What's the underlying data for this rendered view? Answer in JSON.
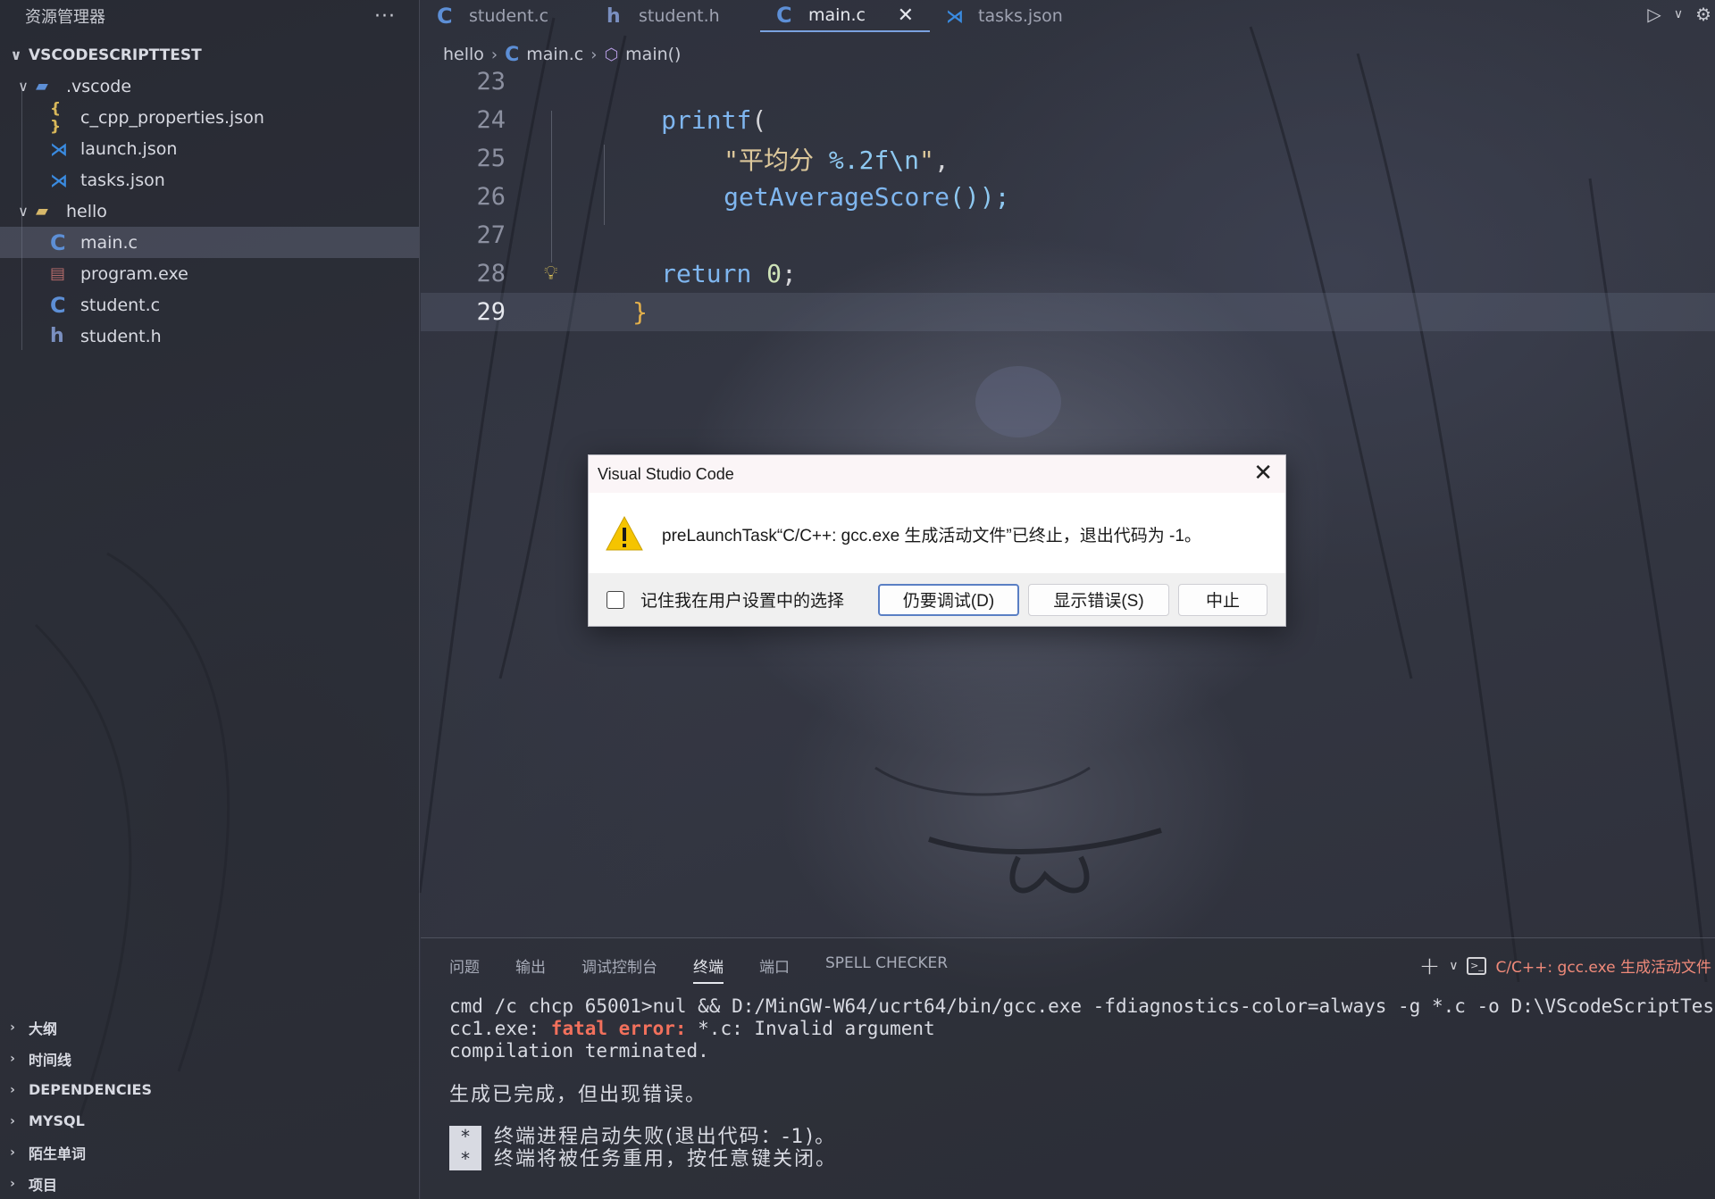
{
  "sidebar": {
    "title": "资源管理器",
    "more": "···",
    "root": "VSCODESCRIPTTEST",
    "tree": {
      "vscode_folder": ".vscode",
      "c_cpp_properties": "c_cpp_properties.json",
      "launch": "launch.json",
      "tasks": "tasks.json",
      "hello_folder": "hello",
      "main_c": "main.c",
      "program_exe": "program.exe",
      "student_c": "student.c",
      "student_h": "student.h"
    },
    "sections": [
      "大纲",
      "时间线",
      "DEPENDENCIES",
      "MYSQL",
      "陌生单词",
      "项目"
    ]
  },
  "tabs": [
    "student.c",
    "student.h",
    "main.c",
    "tasks.json"
  ],
  "breadcrumb": {
    "folder": "hello",
    "file": "main.c",
    "symbol": "main()"
  },
  "editor": {
    "line_numbers": [
      "23",
      "24",
      "25",
      "26",
      "27",
      "28",
      "29"
    ],
    "l24": {
      "fn": "printf",
      "paren": "("
    },
    "l25": {
      "str_open": "\"平均分 ",
      "fmt": "%.2f\\n",
      "str_close": "\"",
      "comma": ","
    },
    "l26": {
      "call": "getAverageScore",
      "tail": "());"
    },
    "l28": {
      "kw": "return",
      "num": "0",
      "semi": ";"
    },
    "l29": {
      "brace": "}"
    }
  },
  "panel": {
    "tabs": [
      "问题",
      "输出",
      "调试控制台",
      "终端",
      "端口",
      "SPELL CHECKER"
    ],
    "active_tab": "终端",
    "task": "C/C++: gcc.exe 生成活动文件",
    "terminal": {
      "cmd": "cmd /c chcp 65001>nul && D:/MinGW-W64/ucrt64/bin/gcc.exe -fdiagnostics-color=always -g *.c -o D:\\VScodeScriptTes",
      "err_prefix": "cc1.exe: ",
      "err_word": "fatal error:",
      "err_rest": " *.c: Invalid argument",
      "terminated": "compilation terminated.",
      "done": "生成已完成，但出现错误。",
      "star": "*",
      "fail1": "终端进程启动失败(退出代码：-1)。",
      "fail2": "终端将被任务重用，按任意键关闭。"
    }
  },
  "dialog": {
    "title": "Visual Studio Code",
    "message": "preLaunchTask“C/C++: gcc.exe 生成活动文件”已终止，退出代码为 -1。",
    "checkbox_label": "记住我在用户设置中的选择",
    "btn_debug": "仍要调试(D)",
    "btn_errors": "显示错误(S)",
    "btn_abort": "中止"
  }
}
